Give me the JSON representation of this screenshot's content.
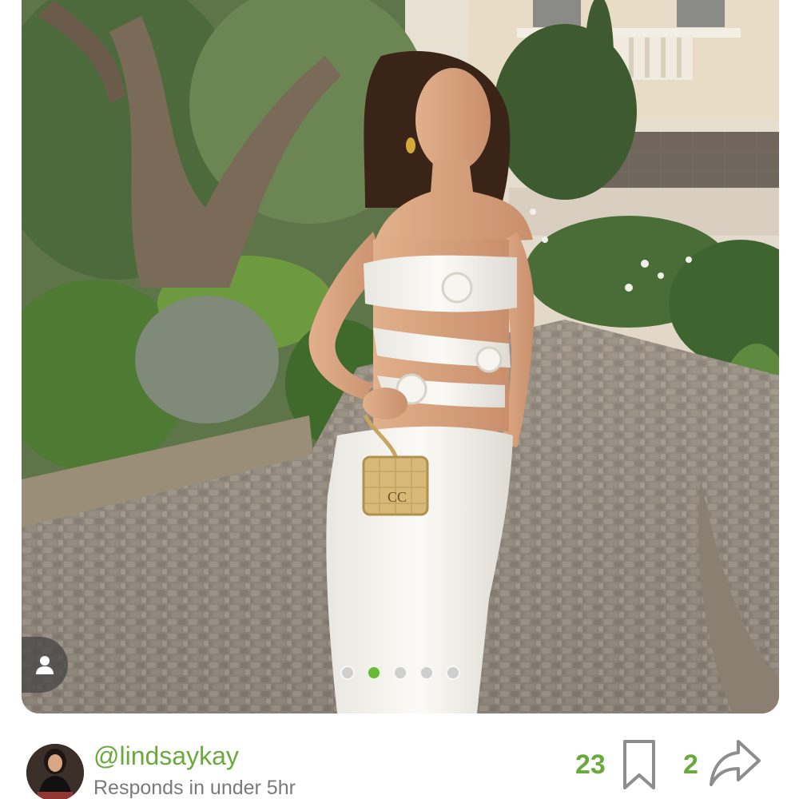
{
  "listing": {
    "photo_alt": "Woman in white strapless rosette cut-out maxi dress holding a tan quilted mini bag",
    "carousel": {
      "total": 5,
      "active_index": 1
    }
  },
  "seller": {
    "username": "@lindsaykay",
    "response_time": "Responds in under 5hr"
  },
  "actions": {
    "like_count": "23",
    "share_count": "2"
  },
  "icons": {
    "profile": "user-icon",
    "like": "bookmark-icon",
    "share": "share-arrow-icon"
  },
  "colors": {
    "accent_green": "#6aaa3c",
    "active_dot": "#69b836",
    "muted_text": "#7a7a7a"
  }
}
